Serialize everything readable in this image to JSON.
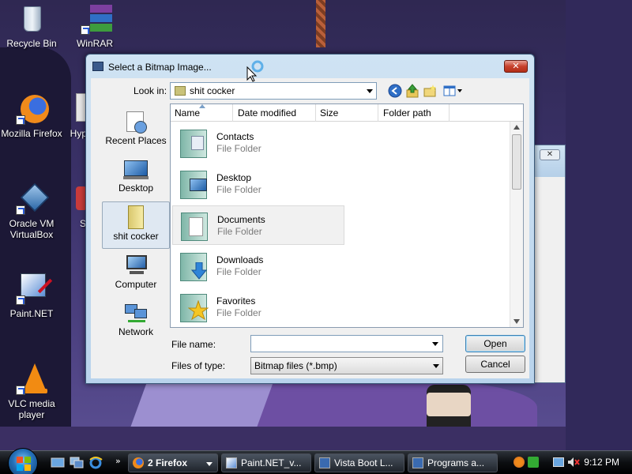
{
  "desktop": {
    "icons": [
      {
        "label": "Recycle Bin",
        "icon": "recycle-bin-icon"
      },
      {
        "label": "WinRAR",
        "icon": "winrar-icon"
      },
      {
        "label": "Mozilla Firefox",
        "icon": "firefox-icon"
      },
      {
        "label": "Hyp",
        "icon": "hypercam-icon"
      },
      {
        "label": "Oracle VM",
        "label2": "VirtualBox",
        "icon": "virtualbox-icon"
      },
      {
        "label": "S",
        "icon": "app-icon"
      },
      {
        "label": "Paint.NET",
        "icon": "paintnet-icon"
      },
      {
        "label": "VLC media",
        "label2": "player",
        "icon": "vlc-icon"
      }
    ]
  },
  "dialog": {
    "title": "Select a Bitmap Image...",
    "close_label": "✕",
    "look_in_label": "Look in:",
    "look_in_value": "shit cocker",
    "places": [
      {
        "label": "Recent Places",
        "icon": "recent-places-icon"
      },
      {
        "label": "Desktop",
        "icon": "desktop-icon"
      },
      {
        "label": "shit cocker",
        "icon": "user-folder-icon",
        "selected": true
      },
      {
        "label": "Computer",
        "icon": "computer-icon"
      },
      {
        "label": "Network",
        "icon": "network-icon"
      }
    ],
    "columns": [
      "Name",
      "Date modified",
      "Size",
      "Folder path"
    ],
    "files": [
      {
        "name": "Contacts",
        "type": "File Folder",
        "icon": "contacts-folder-icon"
      },
      {
        "name": "Desktop",
        "type": "File Folder",
        "icon": "desktop-folder-icon"
      },
      {
        "name": "Documents",
        "type": "File Folder",
        "icon": "documents-folder-icon",
        "selected": true
      },
      {
        "name": "Downloads",
        "type": "File Folder",
        "icon": "downloads-folder-icon"
      },
      {
        "name": "Favorites",
        "type": "File Folder",
        "icon": "favorites-folder-icon"
      }
    ],
    "file_name_label": "File name:",
    "file_name_value": "",
    "files_of_type_label": "Files of type:",
    "files_of_type_value": "Bitmap files (*.bmp)",
    "open_label": "Open",
    "cancel_label": "Cancel"
  },
  "background_window": {
    "close_label": "✕"
  },
  "taskbar": {
    "tasks": [
      {
        "label": "2 Firefox",
        "icon": "firefox-icon"
      },
      {
        "label": "Paint.NET_v...",
        "icon": "paintnet-icon"
      },
      {
        "label": "Vista Boot L...",
        "icon": "window-icon"
      },
      {
        "label": "Programs a...",
        "icon": "window-icon"
      }
    ],
    "clock": "9:12 PM"
  },
  "colors": {
    "accent": "#2a5bd7",
    "titlebar": "#c4dbf0",
    "close": "#c7412c"
  }
}
